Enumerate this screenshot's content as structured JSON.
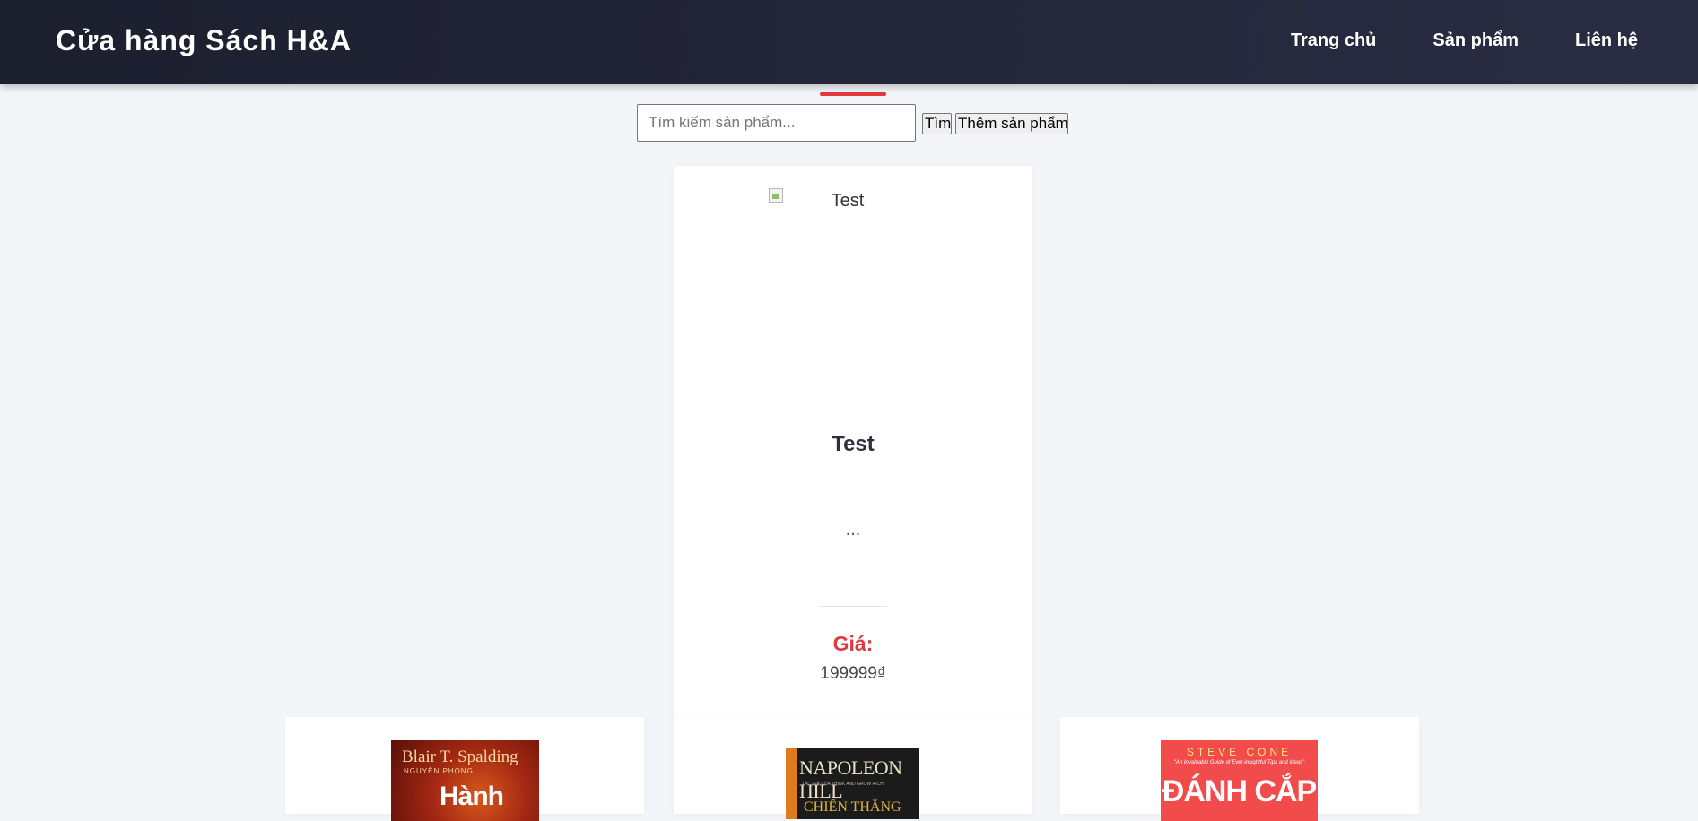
{
  "header": {
    "brand": "Cửa hàng Sách H&A",
    "nav": [
      "Trang chủ",
      "Sản phẩm",
      "Liên hệ"
    ]
  },
  "toolbar": {
    "search_placeholder": "Tìm kiếm sản phẩm...",
    "search_button": "Tìm",
    "add_button": "Thêm sản phẩm"
  },
  "featured_product": {
    "image_alt": "Test",
    "name": "Test",
    "description": "...",
    "price_label": "Giá:",
    "price": "199999₫"
  },
  "products": [
    {
      "cover_author": "Blair T. Spalding",
      "cover_translator": "NGUYÊN PHONG",
      "cover_title": "Hành"
    },
    {
      "cover_author": "NAPOLEON HILL",
      "cover_subtitle": "TÁC GIẢ CỦA THINK AND GROW RICH",
      "cover_title": "CHIẾN THẮNG"
    },
    {
      "cover_author": "STEVE CONE",
      "cover_tagline": "\"An Invaluable Guide of Ever-insightful Tips and Ideas\"",
      "cover_title": "ĐÁNH CẮP"
    }
  ],
  "colors": {
    "header_bg": "#1c1f2e",
    "accent": "#e0393e",
    "page_bg": "#f4f5f9"
  }
}
